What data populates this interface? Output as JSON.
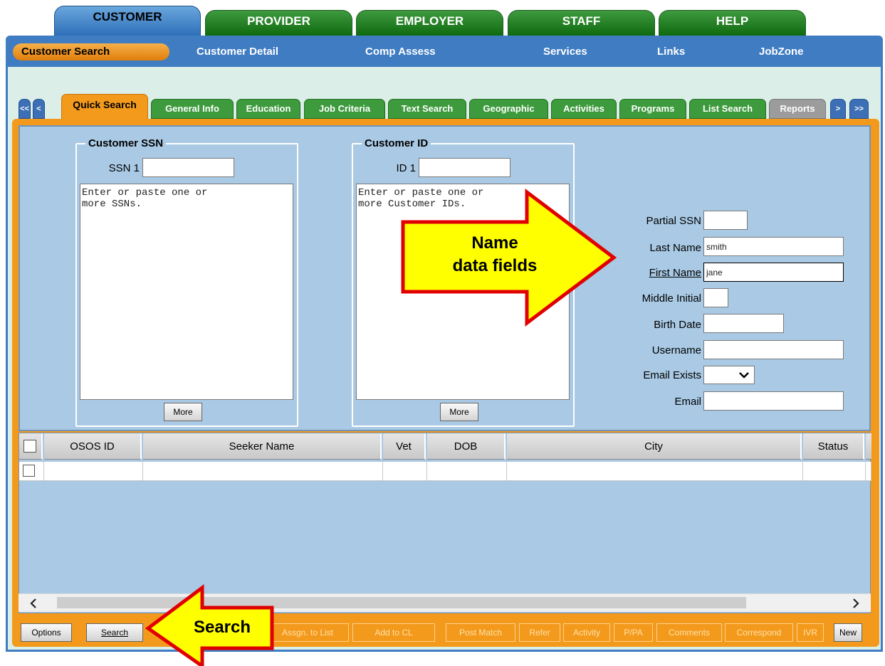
{
  "top_tabs": [
    "CUSTOMER",
    "PROVIDER",
    "EMPLOYER",
    "STAFF",
    "HELP"
  ],
  "sub_nav": {
    "selected": "Customer Search",
    "links": [
      "Customer Detail",
      "Comp Assess",
      "Services",
      "Links",
      "JobZone"
    ]
  },
  "quick_tabs": {
    "nav_left": [
      "<<",
      "<"
    ],
    "selected": "Quick Search",
    "tabs": [
      "General Info",
      "Education",
      "Job Criteria",
      "Text Search",
      "Geographic",
      "Activities",
      "Programs",
      "List Search"
    ],
    "disabled": [
      "Reports"
    ],
    "nav_right": [
      ">",
      ">>"
    ]
  },
  "ssn_group": {
    "legend": "Customer SSN",
    "label": "SSN 1",
    "value": "",
    "textarea": "Enter or paste one or\nmore SSNs.",
    "more": "More"
  },
  "id_group": {
    "legend": "Customer ID",
    "label": "ID 1",
    "value": "",
    "textarea": "Enter or paste one or\nmore Customer IDs.",
    "more": "More"
  },
  "fields": {
    "partial_ssn": {
      "label": "Partial SSN",
      "value": ""
    },
    "last_name": {
      "label": "Last Name",
      "value": "smith"
    },
    "first_name": {
      "label": "First Name",
      "value": "jane"
    },
    "middle_initial": {
      "label": "Middle Initial",
      "value": ""
    },
    "birth_date": {
      "label": "Birth Date",
      "value": ""
    },
    "username": {
      "label": "Username",
      "value": ""
    },
    "email_exists": {
      "label": "Email Exists",
      "value": ""
    },
    "email": {
      "label": "Email",
      "value": ""
    }
  },
  "grid": {
    "columns": [
      "OSOS ID",
      "Seeker Name",
      "Vet",
      "DOB",
      "City",
      "Status"
    ]
  },
  "buttons": [
    "Options",
    "Search",
    "Assgn. to List",
    "Add to CL",
    "Post Match",
    "Refer",
    "Activity",
    "P/PA",
    "Comments",
    "Correspond",
    "IVR",
    "New"
  ],
  "annotations": {
    "name_fields": "Name\ndata fields",
    "search": "Search"
  },
  "colors": {
    "tab_green": "#1a7a1a",
    "tab_blue": "#3f7cc2",
    "accent_orange": "#f39a1c",
    "panel_blue": "#a9c9e4",
    "arrow_yellow": "#ffff00",
    "arrow_red": "#e00000"
  }
}
